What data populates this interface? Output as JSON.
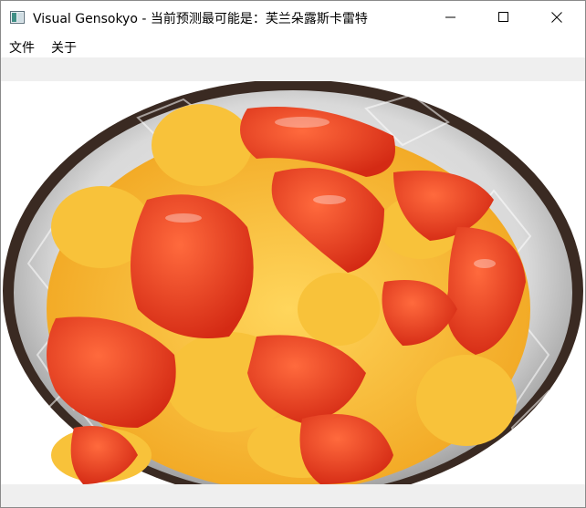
{
  "window": {
    "title": "Visual Gensokyo - 当前预测最可能是：芙兰朵露斯卡雷特",
    "icon": "app-icon"
  },
  "controls": {
    "minimize_icon": "minimize-icon",
    "maximize_icon": "maximize-icon",
    "close_icon": "close-icon"
  },
  "menu": {
    "file_label": "文件",
    "about_label": "关于"
  },
  "image": {
    "subject_icon": "food-photo"
  },
  "colors": {
    "background": "#ffffff",
    "toolbar": "#efefef",
    "tomato": "#e8361e",
    "egg": "#f6b425"
  }
}
